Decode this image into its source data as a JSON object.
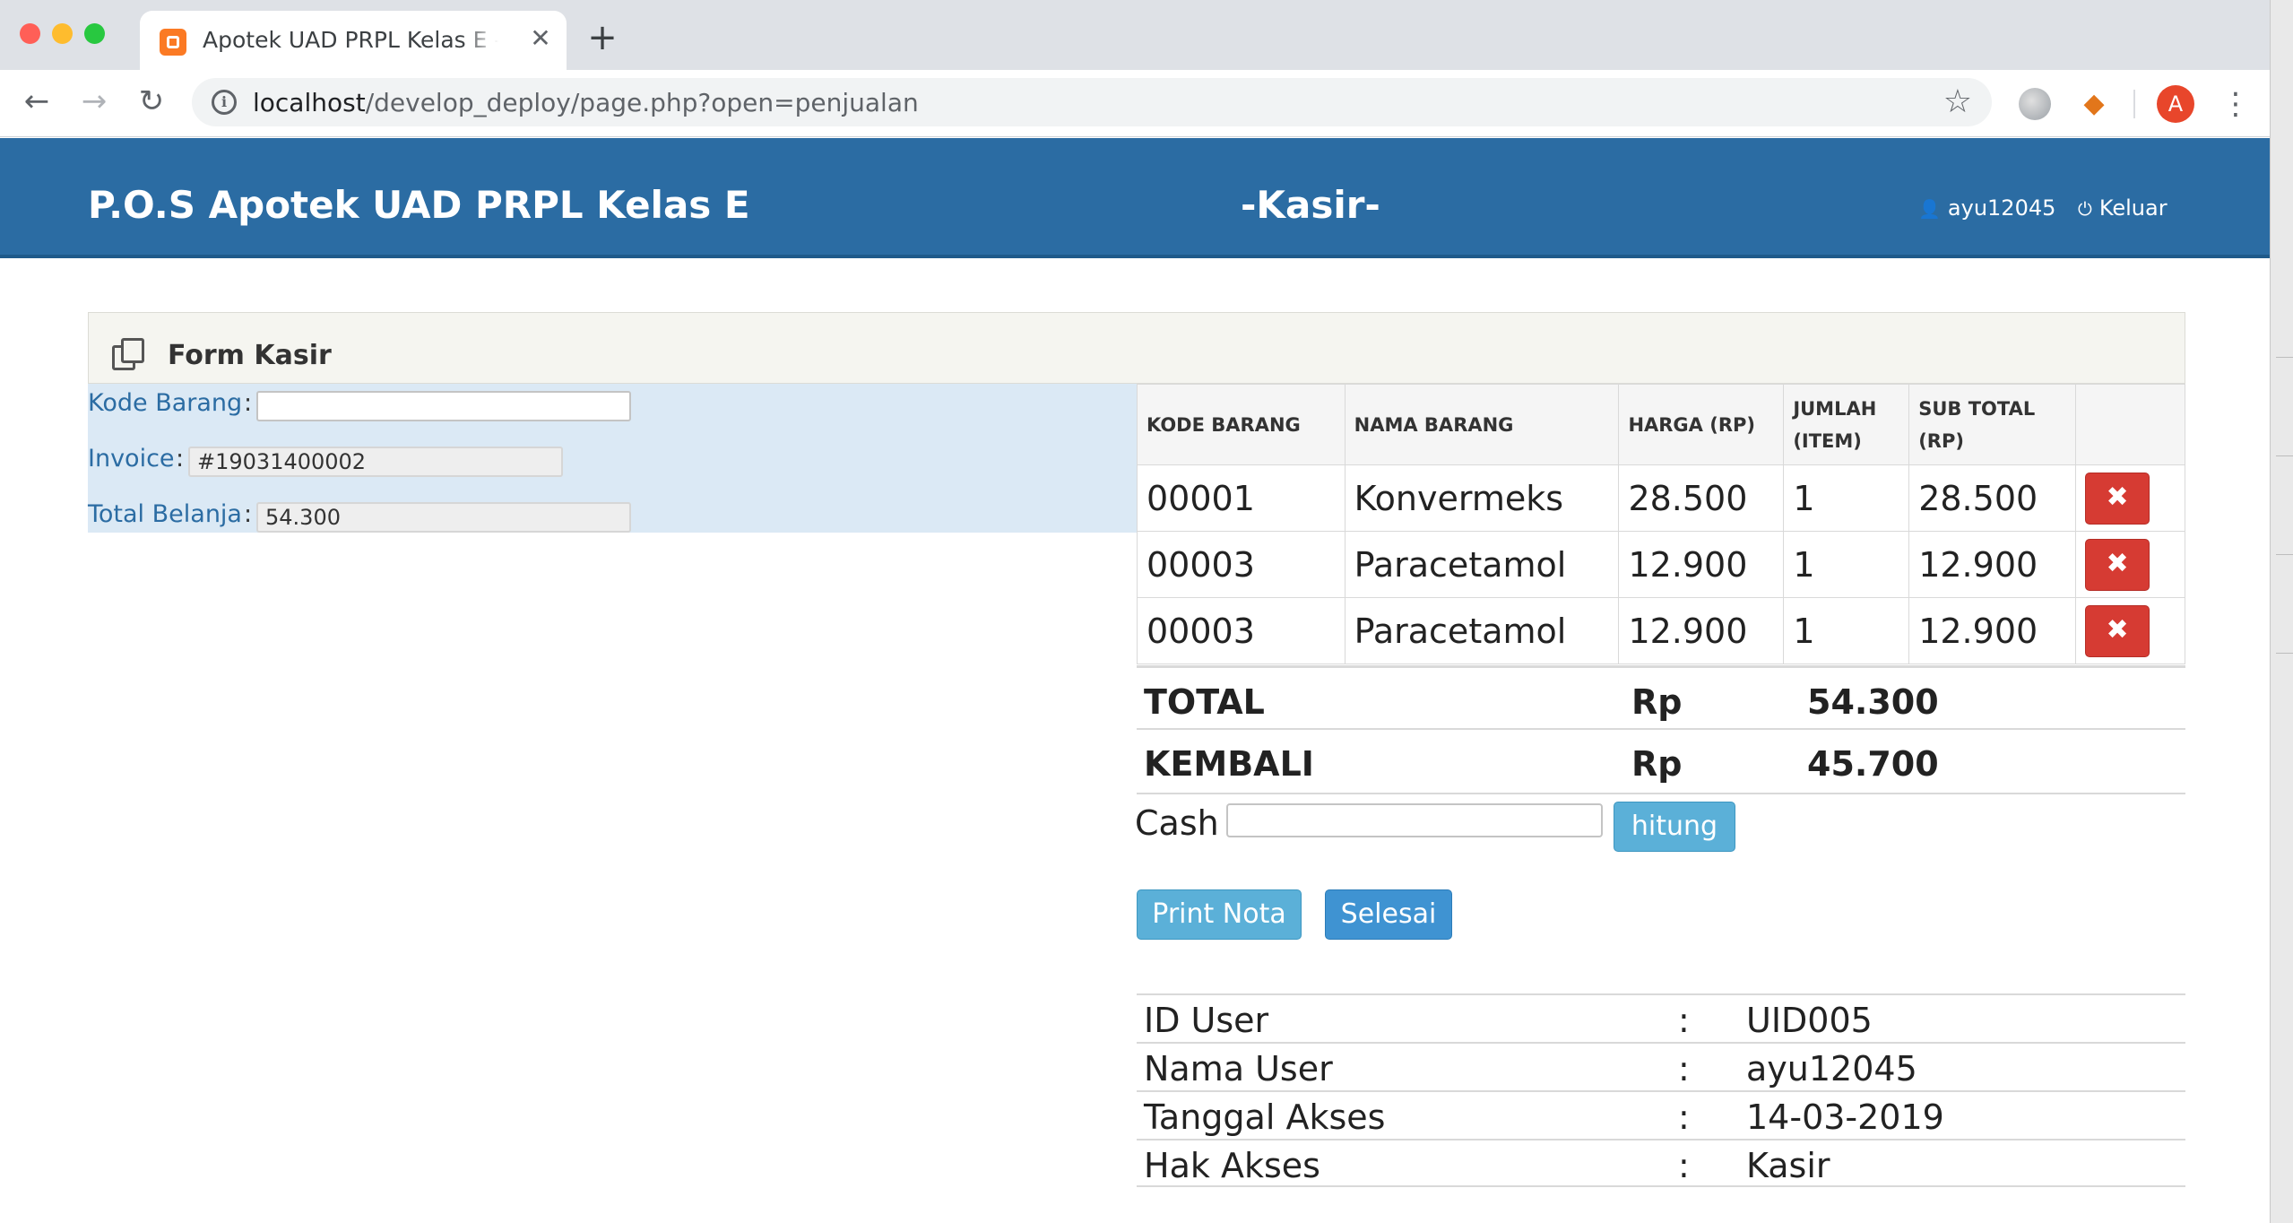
{
  "browser": {
    "tab_title": "Apotek UAD PRPL Kelas E - POS",
    "tab_close": "✕",
    "new_tab": "+",
    "url_host": "localhost",
    "url_path": "/develop_deploy/page.php?open=penjualan",
    "avatar_letter": "A"
  },
  "header": {
    "brand": "P.O.S Apotek UAD PRPL Kelas E",
    "role": "-Kasir-",
    "user": "ayu12045",
    "logout": "Keluar"
  },
  "panel": {
    "title": "Form Kasir"
  },
  "form": {
    "kode_barang_label": "Kode Barang",
    "invoice_label": "Invoice",
    "invoice_value": "#19031400002",
    "total_belanja_label": "Total Belanja",
    "total_belanja_value": "54.300",
    "colon": ":"
  },
  "table": {
    "headers": [
      "KODE BARANG",
      "NAMA BARANG",
      "HARGA (RP)",
      "JUMLAH (ITEM)",
      "SUB TOTAL (RP)",
      ""
    ],
    "rows": [
      {
        "kode": "00001",
        "nama": "Konvermeks",
        "harga": "28.500",
        "jumlah": "1",
        "subtotal": "28.500"
      },
      {
        "kode": "00003",
        "nama": "Paracetamol",
        "harga": "12.900",
        "jumlah": "1",
        "subtotal": "12.900"
      },
      {
        "kode": "00003",
        "nama": "Paracetamol",
        "harga": "12.900",
        "jumlah": "1",
        "subtotal": "12.900"
      }
    ],
    "delete_glyph": "✖"
  },
  "summary": {
    "total_label": "TOTAL",
    "kembali_label": "KEMBALI",
    "currency": "Rp",
    "total_value": "54.300",
    "kembali_value": "45.700"
  },
  "cash": {
    "label": "Cash",
    "hitung": "hitung"
  },
  "actions": {
    "print": "Print Nota",
    "selesai": "Selesai"
  },
  "user_info": [
    {
      "key": "ID User",
      "value": "UID005"
    },
    {
      "key": "Nama User",
      "value": "ayu12045"
    },
    {
      "key": "Tanggal Akses",
      "value": "14-03-2019"
    },
    {
      "key": "Hak Akses",
      "value": "Kasir"
    }
  ],
  "colors": {
    "header_blue": "#2b6ca3",
    "delete_red": "#d63b33",
    "button_light_blue": "#5bb0d8",
    "button_blue": "#3f93d2",
    "form_bg": "#dbe9f5"
  }
}
